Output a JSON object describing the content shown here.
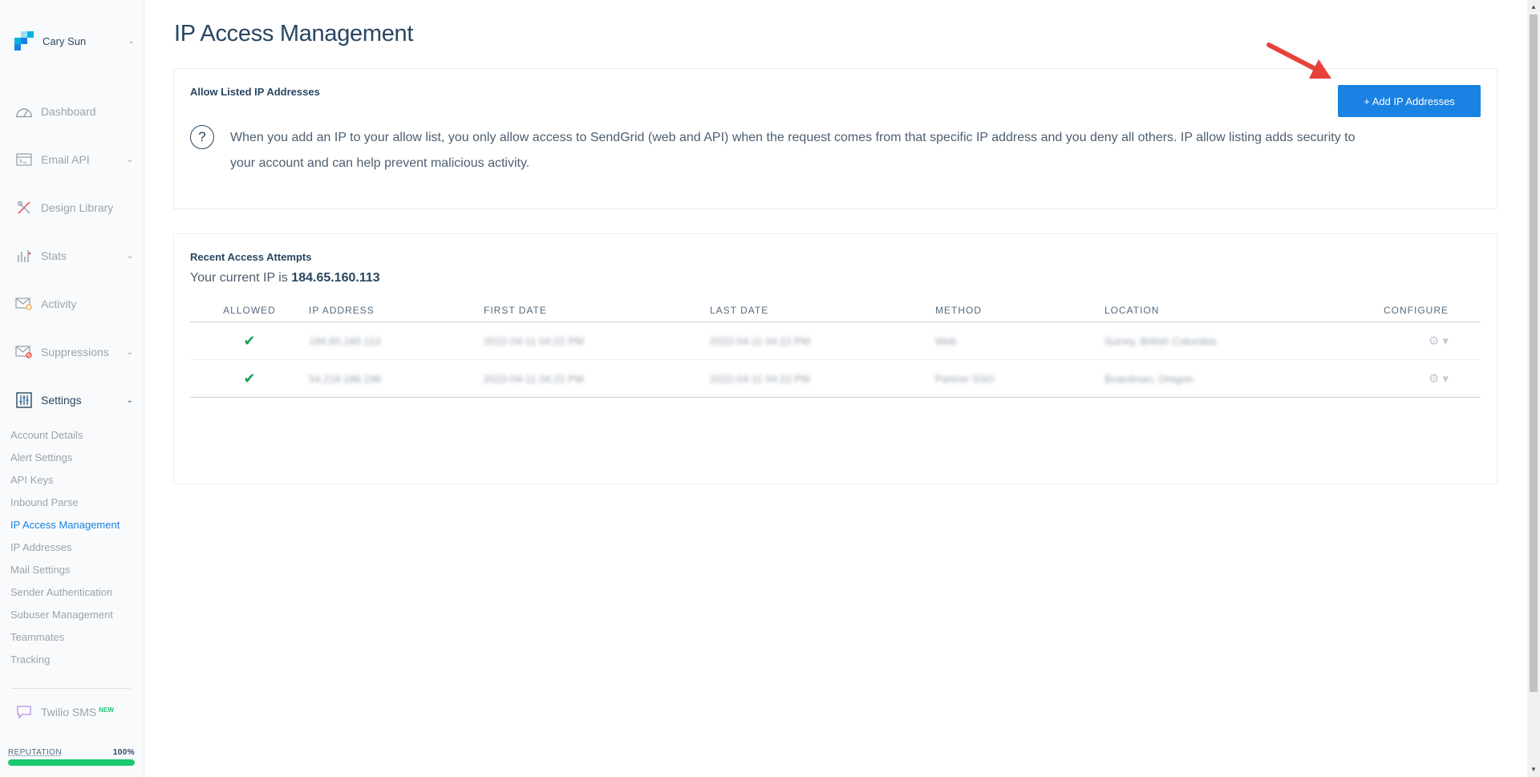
{
  "account": {
    "name": "Cary Sun"
  },
  "nav": {
    "dashboard": "Dashboard",
    "email_api": "Email API",
    "design_library": "Design Library",
    "stats": "Stats",
    "activity": "Activity",
    "suppressions": "Suppressions",
    "settings": "Settings",
    "twilio_sms": "Twilio SMS",
    "new_badge": "NEW"
  },
  "settings_menu": [
    "Account Details",
    "Alert Settings",
    "API Keys",
    "Inbound Parse",
    "IP Access Management",
    "IP Addresses",
    "Mail Settings",
    "Sender Authentication",
    "Subuser Management",
    "Teammates",
    "Tracking"
  ],
  "reputation": {
    "label": "REPUTATION",
    "value": "100%",
    "fraction": 1.0
  },
  "page": {
    "title": "IP Access Management"
  },
  "allow_list": {
    "title": "Allow Listed IP Addresses",
    "add_button": "+ Add IP Addresses",
    "info": "When you add an IP to your allow list, you only allow access to SendGrid (web and API) when the request comes from that specific IP address and you deny all others. IP allow listing adds security to your account and can help prevent malicious activity."
  },
  "attempts": {
    "title": "Recent Access Attempts",
    "current_ip_prefix": "Your current IP is",
    "current_ip": "184.65.160.113",
    "columns": [
      "ALLOWED",
      "IP ADDRESS",
      "FIRST DATE",
      "LAST DATE",
      "METHOD",
      "LOCATION",
      "CONFIGURE"
    ],
    "rows": [
      {
        "ip": "184.65.160.113",
        "first": "2022-04-11 04:22 PM",
        "last": "2022-04-11 04:22 PM",
        "method": "Web",
        "location": "Surrey, British Columbia"
      },
      {
        "ip": "54.218.186.196",
        "first": "2022-04-11 04:22 PM",
        "last": "2022-04-11 04:22 PM",
        "method": "Partner SSO",
        "location": "Boardman, Oregon"
      }
    ]
  },
  "colors": {
    "accent": "#1a82e2",
    "success": "#18c96e",
    "text": "#294661",
    "arrow": "#e8413b"
  }
}
